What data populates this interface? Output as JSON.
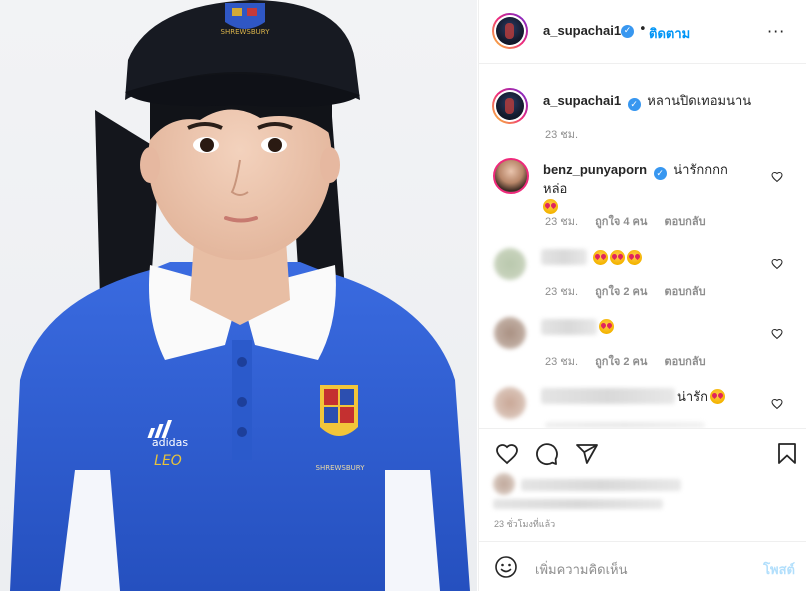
{
  "header": {
    "username": "a_supachai1",
    "separator": "•",
    "follow_label": "ติดตาม",
    "more_label": "···"
  },
  "caption": {
    "username": "a_supachai1",
    "text": "หลานปิดเทอมนาน",
    "time": "23 ชม."
  },
  "comments": [
    {
      "username": "benz_punyaporn",
      "text": "น่ารักกกก หล่อ",
      "time": "23 ชม.",
      "likes": "ถูกใจ 4 คน",
      "reply_label": "ตอบกลับ"
    },
    {
      "username": "",
      "text": "",
      "time": "23 ชม.",
      "likes": "ถูกใจ 2 คน",
      "reply_label": "ตอบกลับ"
    },
    {
      "username": "",
      "text": "",
      "time": "23 ชม.",
      "likes": "ถูกใจ 2 คน",
      "reply_label": "ตอบกลับ"
    },
    {
      "username": "",
      "text": "น่ารัก",
      "time": "",
      "likes": "",
      "reply_label": ""
    }
  ],
  "actions": {
    "like_icon": "heart-icon",
    "comment_icon": "comment-icon",
    "share_icon": "share-icon",
    "save_icon": "bookmark-icon"
  },
  "post_time": "23 ชั่วโมงที่แล้ว",
  "composer": {
    "placeholder": "เพิ่มความคิดเห็น",
    "post_label": "โพสต์"
  },
  "photo": {
    "shirt_brand": "adidas",
    "shirt_name": "LEO",
    "crest_text": "SHREWSBURY",
    "cap_text": "SHREWSBURY"
  },
  "colors": {
    "accent": "#0095f6",
    "verified": "#3897f0",
    "shirt": "#2f5fd0"
  }
}
